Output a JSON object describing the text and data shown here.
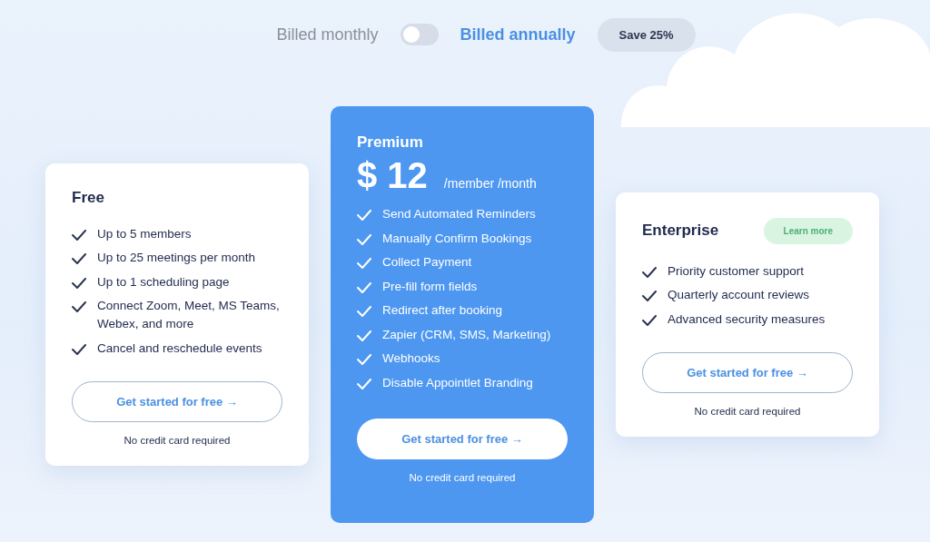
{
  "billing": {
    "options": [
      {
        "label": "Billed monthly",
        "selected": false
      },
      {
        "label": "Billed annually",
        "selected": true
      }
    ],
    "toggle": {
      "on": false
    },
    "badge": "Save 25%"
  },
  "plans": [
    {
      "kind": "standard",
      "name": "Free",
      "features": [
        "Up to 5 members",
        "Up to 25 meetings per month",
        "Up to 1 scheduling page",
        "Connect Zoom, Meet, MS Teams, Webex, and more",
        "Cancel and reschedule events"
      ],
      "button": "Get started for free →",
      "note": "No credit card required"
    },
    {
      "kind": "featured",
      "name": "Premium",
      "price": "$ 12",
      "price_unit": "/member /month",
      "features": [
        "Send Automated Reminders",
        "Manually Confirm Bookings",
        "Collect Payment",
        "Pre-fill form fields",
        "Redirect after booking",
        "Zapier (CRM, SMS, Marketing)",
        "Webhooks",
        "Disable Appointlet Branding"
      ],
      "button": "Get started for free →",
      "note": "No credit card required"
    },
    {
      "kind": "standard",
      "name": "Enterprise",
      "link": "Learn more",
      "features": [
        "Priority customer support",
        "Quarterly account reviews",
        "Advanced security measures"
      ],
      "button": "Get started for free →",
      "note": "No credit card required"
    }
  ]
}
